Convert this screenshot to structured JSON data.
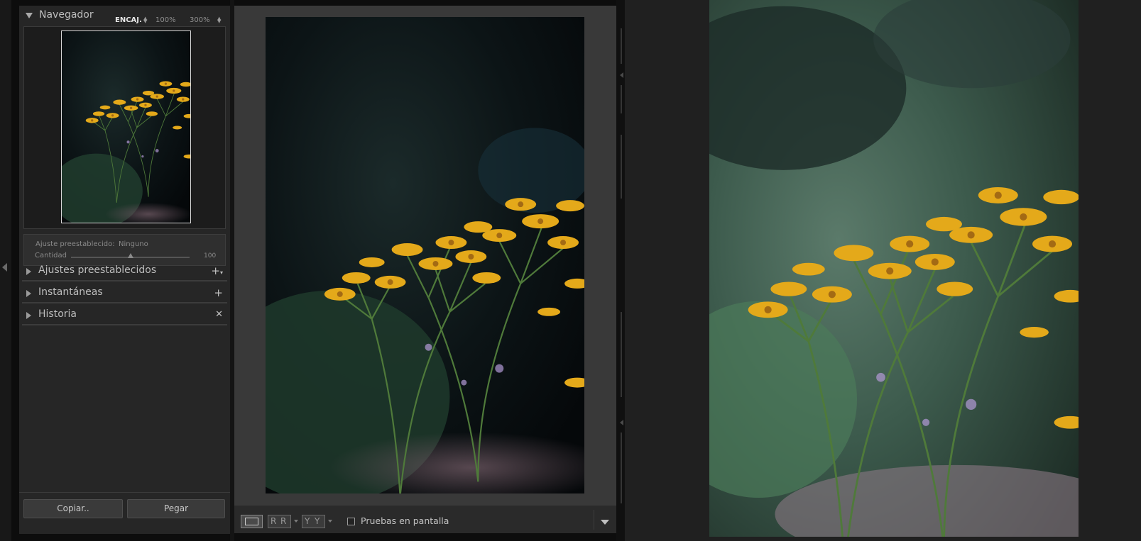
{
  "navigator": {
    "title": "Navegador",
    "zoom_options": [
      "ENCAJ.",
      "100%",
      "300%"
    ]
  },
  "preset_box": {
    "preset_label": "Ajuste preestablecido:",
    "preset_value": "Ninguno",
    "amount_label": "Cantidad",
    "amount_value": "100",
    "amount_fraction": 0.5
  },
  "sections": [
    {
      "label": "Ajustes preestablecidos",
      "action_icon": "plus-dropdown-icon"
    },
    {
      "label": "Instantáneas",
      "action_icon": "plus-icon"
    },
    {
      "label": "Historia",
      "action_icon": "close-icon"
    }
  ],
  "buttons": {
    "copy": "Copiar..",
    "paste": "Pegar"
  },
  "toolbar": {
    "view_mode_icon": "loupe-view-icon",
    "before_after_left": "R",
    "before_after_right": "R",
    "swap_left": "Y",
    "swap_right": "Y",
    "soft_proofing": "Pruebas en pantalla"
  },
  "colors": {
    "panel_bg": "#262626",
    "view_bg": "#393939",
    "flower_yellow": "#e4a91a",
    "stem_green": "#4f7a3a"
  }
}
